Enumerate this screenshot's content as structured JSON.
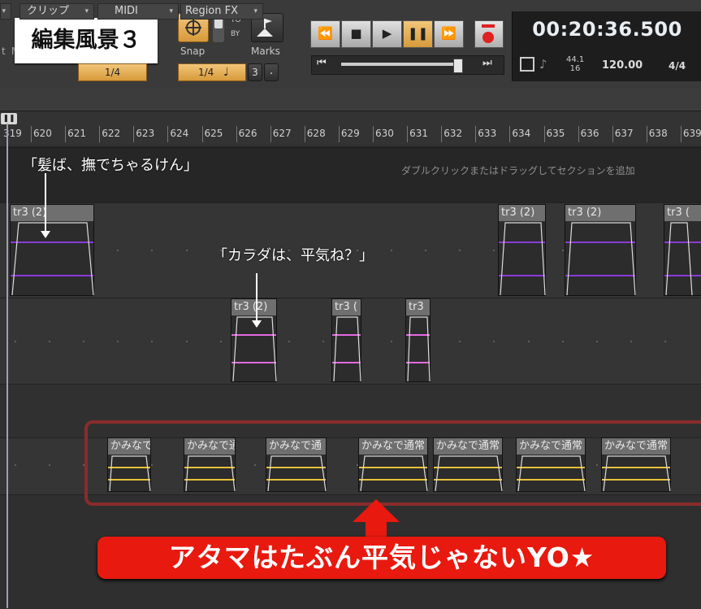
{
  "title_overlay": "編集風景３",
  "toolbar": {
    "left_fragment_1": "t",
    "left_fragment_2": "M",
    "grid_value_left": "1/4",
    "snap_label": "Snap",
    "snap_to": "TO",
    "snap_by": "BY",
    "snap_value": "1/4",
    "note_glyph": "♩",
    "triplet": "3",
    "dot": ".",
    "marks_label": "Marks"
  },
  "transport": {
    "buttons": [
      "⏪",
      "■",
      "▶",
      "❚❚",
      "⏩"
    ],
    "active_index": 3,
    "time": "00:20:36.500",
    "sample_rate": "44.1",
    "bit_depth": "16",
    "tempo": "120.00",
    "meter": "4/4",
    "position_fraction": 0.95
  },
  "menus": [
    "",
    "クリップ",
    "MIDI",
    "Region FX"
  ],
  "ruler": {
    "first_label": "319",
    "labels": [
      "620",
      "621",
      "622",
      "623",
      "624",
      "625",
      "626",
      "627",
      "628",
      "629",
      "630",
      "631",
      "632",
      "633",
      "634",
      "635",
      "636",
      "637",
      "638",
      "639"
    ]
  },
  "section_hint": "ダブルクリックまたはドラッグしてセクションを追加",
  "lanes": {
    "lane1_clips": [
      "tr3 (2)",
      "tr3 (2)",
      "tr3 (2)",
      "tr3 ("
    ],
    "lane2_clips": [
      "tr3 (2)",
      "tr3 (",
      "tr3"
    ],
    "lane4_clips": [
      "かみなで",
      "かみなで通",
      "かみなで通",
      "かみなで通常",
      "かみなで通常",
      "かみなで通常",
      "かみなで通常"
    ]
  },
  "annotations": {
    "note1": "「髪ば、撫でちゃるけん」",
    "note2": "「カラダは、平気ね？」",
    "caption": "アタマはたぶん平気じゃないYO★"
  },
  "colors": {
    "purple": "#8a3ad6",
    "pink": "#e36ae0",
    "yellow": "#e8c13a",
    "caption_red": "#e8190f"
  }
}
